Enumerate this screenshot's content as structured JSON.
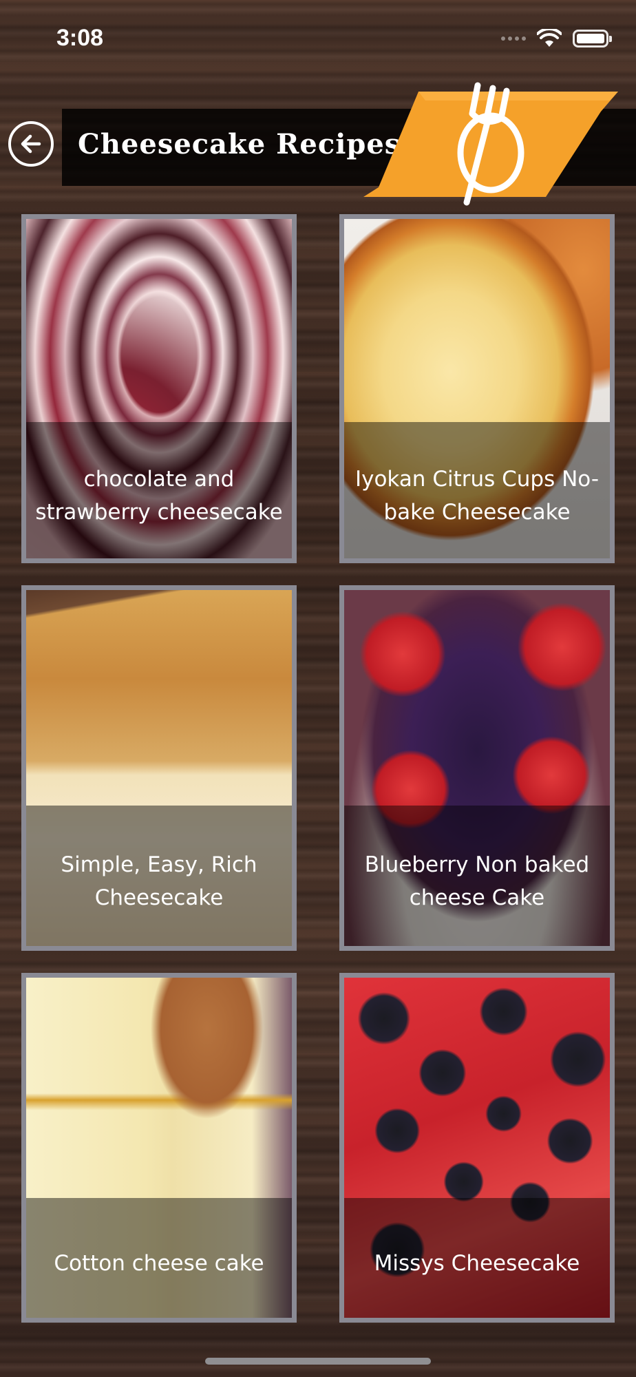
{
  "status_bar": {
    "time": "3:08",
    "icons": [
      "signal-icon",
      "wifi-icon",
      "battery-icon"
    ]
  },
  "header": {
    "title": "Cheesecake Recipes",
    "back_icon": "back-arrow-icon",
    "logo_icon": "fork-logo-icon",
    "accent_color": "#f5a12a"
  },
  "recipes": [
    {
      "title": "chocolate and strawberry cheesecake"
    },
    {
      "title": "Iyokan Citrus Cups No-bake Cheesecake"
    },
    {
      "title": "Simple, Easy, Rich Cheesecake"
    },
    {
      "title": "Blueberry Non baked cheese Cake"
    },
    {
      "title": "Cotton cheese cake"
    },
    {
      "title": "Missys Cheesecake"
    }
  ]
}
